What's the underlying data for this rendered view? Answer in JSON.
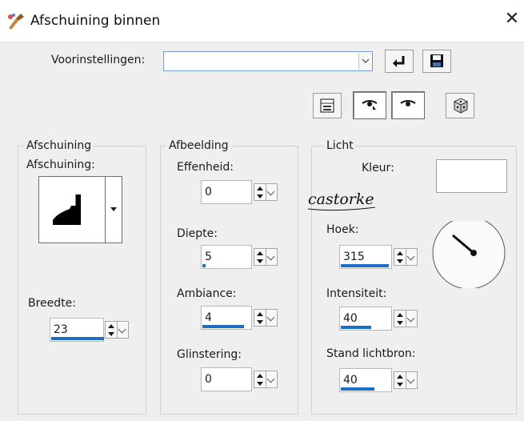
{
  "window": {
    "title": "Afschuining binnen",
    "close_glyph": "✕"
  },
  "presets": {
    "label": "Voorinstellingen:",
    "value": ""
  },
  "groups": {
    "bevel": {
      "title": "Afschuining",
      "shape_label": "Afschuining:",
      "width_label": "Breedte:",
      "width_value": "23"
    },
    "image": {
      "title": "Afbeelding",
      "fields": [
        {
          "label": "Effenheid:",
          "value": "0"
        },
        {
          "label": "Diepte:",
          "value": "5"
        },
        {
          "label": "Ambiance:",
          "value": "4"
        },
        {
          "label": "Glinstering:",
          "value": "0"
        }
      ]
    },
    "light": {
      "title": "Licht",
      "color_label": "Kleur:",
      "color_value": "#ffffff",
      "fields": [
        {
          "label": "Hoek:",
          "value": "315"
        },
        {
          "label": "Intensiteit:",
          "value": "40"
        },
        {
          "label": "Stand lichtbron:",
          "value": "40"
        }
      ]
    }
  },
  "watermark": "castorke",
  "icons": {
    "app": "paintbrush-icon",
    "reset": "reset-arrow-icon",
    "save": "floppy-disk-icon",
    "preview": "proof-toggle-icon",
    "eye_auto": "auto-proof-eye-icon",
    "eye": "eye-icon",
    "random": "dice-icon"
  }
}
